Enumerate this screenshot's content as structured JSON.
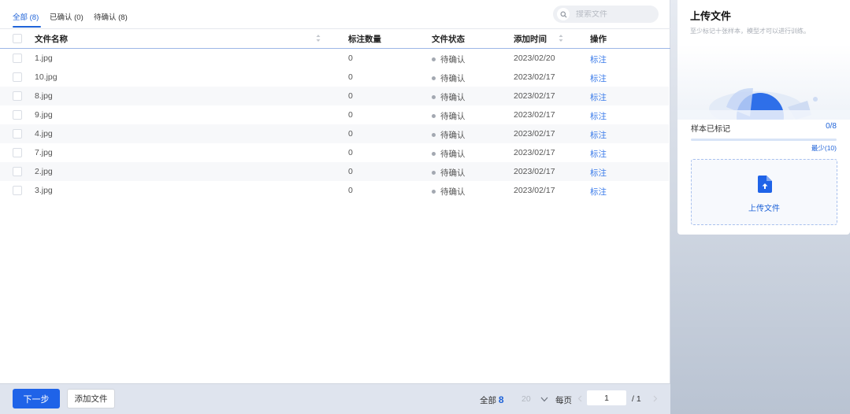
{
  "tabs": [
    {
      "label": "全部 (8)",
      "active": true
    },
    {
      "label": "已确认 (0)",
      "active": false
    },
    {
      "label": "待确认 (8)",
      "active": false
    }
  ],
  "search": {
    "placeholder": "搜索文件",
    "icon": "search-icon"
  },
  "table": {
    "headers": {
      "name": "文件名称",
      "count": "标注数量",
      "status": "文件状态",
      "time": "添加时间",
      "action": "操作"
    },
    "rows": [
      {
        "name": "1.jpg",
        "count": "0",
        "status": "待确认",
        "time": "2023/02/20",
        "action": "标注"
      },
      {
        "name": "10.jpg",
        "count": "0",
        "status": "待确认",
        "time": "2023/02/17",
        "action": "标注"
      },
      {
        "name": "8.jpg",
        "count": "0",
        "status": "待确认",
        "time": "2023/02/17",
        "action": "标注"
      },
      {
        "name": "9.jpg",
        "count": "0",
        "status": "待确认",
        "time": "2023/02/17",
        "action": "标注"
      },
      {
        "name": "4.jpg",
        "count": "0",
        "status": "待确认",
        "time": "2023/02/17",
        "action": "标注"
      },
      {
        "name": "7.jpg",
        "count": "0",
        "status": "待确认",
        "time": "2023/02/17",
        "action": "标注"
      },
      {
        "name": "2.jpg",
        "count": "0",
        "status": "待确认",
        "time": "2023/02/17",
        "action": "标注"
      },
      {
        "name": "3.jpg",
        "count": "0",
        "status": "待确认",
        "time": "2023/02/17",
        "action": "标注"
      }
    ]
  },
  "footer": {
    "next_label": "下一步",
    "add_label": "添加文件",
    "total_prefix": "全部",
    "total": "8",
    "page_size": "20",
    "page_size_suffix": "每页",
    "page": "1",
    "page_total": "/ 1"
  },
  "panel": {
    "title": "上传文件",
    "subtitle": "至少标记十张样本，模型才可以进行训练。",
    "progress_label": "样本已标记",
    "progress_count": "0/8",
    "progress_fraction": 0,
    "progress_min": "最少(10)",
    "upload_label": "上传文件"
  },
  "colors": {
    "accent": "#1f63e8",
    "link": "#3a7bea",
    "status_dot": "#a3a8b1"
  }
}
